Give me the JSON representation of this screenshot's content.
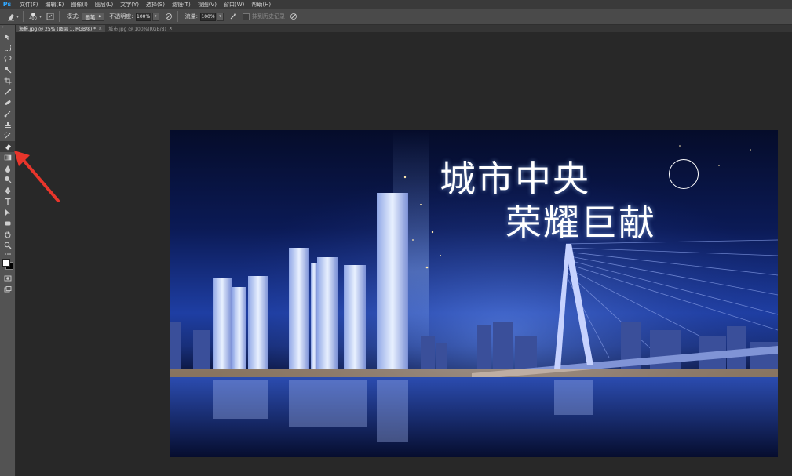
{
  "app": {
    "logo": "Ps"
  },
  "menu": [
    "文件(F)",
    "编辑(E)",
    "图像(I)",
    "图层(L)",
    "文字(Y)",
    "选择(S)",
    "滤镜(T)",
    "视图(V)",
    "窗口(W)",
    "帮助(H)"
  ],
  "options": {
    "brush_size": "400",
    "mode_label": "模式:",
    "mode_value": "画笔",
    "opacity_label": "不透明度:",
    "opacity_value": "100%",
    "flow_label": "流量:",
    "flow_value": "100%",
    "history_label": "抹到历史记录"
  },
  "tabs": [
    {
      "label": "海报.jpg @ 25% (图层 1, RGB/8) *",
      "active": true
    },
    {
      "label": "城市.jpg @ 100%(RGB/8)",
      "active": false
    }
  ],
  "toolbar": {
    "collapse_label": "»",
    "tools": [
      "move-tool",
      "marquee-tool",
      "lasso-tool",
      "quick-select-tool",
      "crop-tool",
      "eyedropper-tool",
      "healing-brush-tool",
      "brush-tool",
      "clone-stamp-tool",
      "history-brush-tool",
      "eraser-tool",
      "gradient-tool",
      "blur-tool",
      "dodge-tool",
      "pen-tool",
      "type-tool",
      "path-select-tool",
      "shape-tool",
      "hand-tool",
      "zoom-tool"
    ],
    "active_tool": "eraser-tool",
    "foreground_color": "#ffffff",
    "background_color": "#000000"
  },
  "document": {
    "headline_1": "城市中央",
    "headline_2": "荣耀巨献"
  },
  "colors": {
    "accent_arrow": "#e8352b",
    "menubar": "#3a3a3a",
    "optionsbar": "#4a4a4a",
    "workspace": "#282828"
  }
}
